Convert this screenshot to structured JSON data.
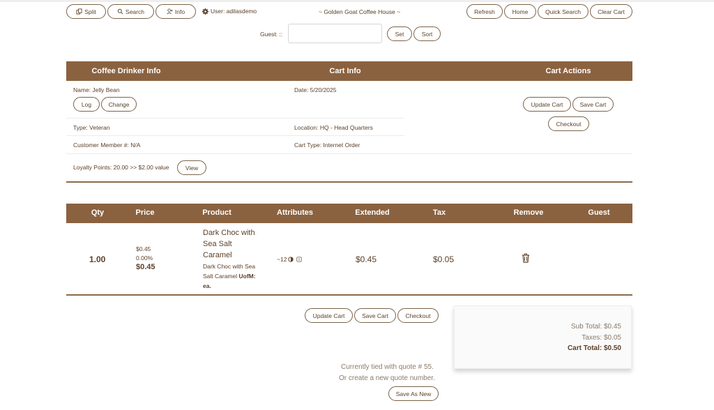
{
  "header": {
    "split_label": "Split",
    "search_label": "Search",
    "info_label": "Info",
    "user_text": "User: adilasdemo",
    "store_name": "~ Golden Goat Coffee House ~",
    "refresh_label": "Refresh",
    "home_label": "Home",
    "quick_search_label": "Quick Search",
    "clear_cart_label": "Clear Cart"
  },
  "guest": {
    "label": "Guest: ::",
    "value": "",
    "set_label": "Set",
    "sort_label": "Sort"
  },
  "info_header": {
    "col1": "Coffee Drinker Info",
    "col2": "Cart Info",
    "col3": "Cart Actions"
  },
  "drinker": {
    "name": "Name: Jelly Bean",
    "log_label": "Log",
    "change_label": "Change",
    "type": "Type: Veteran",
    "member": "Customer Member #: N/A",
    "loyalty": "Loyalty Points: 20.00 >> $2.00 value",
    "view_label": "View"
  },
  "cart_info": {
    "date": "Date: 5/20/2025",
    "location": "Location: HQ - Head Quarters",
    "cart_type": "Cart Type: Internet Order"
  },
  "cart_actions": {
    "update_label": "Update Cart",
    "save_label": "Save Cart",
    "checkout_label": "Checkout"
  },
  "items_table": {
    "columns": [
      "Qty",
      "Price",
      "Product",
      "Attributes",
      "Extended",
      "Tax",
      "Remove",
      "Guest"
    ],
    "rows": [
      {
        "qty": "1.00",
        "price_unit": "$0.45",
        "price_discount": "0.00%",
        "price_final": "$0.45",
        "product_line1": "Dark Choc with",
        "product_line2": "Sea Salt",
        "product_line3": "Caramel",
        "desc_line1": "Dark Choc with Sea",
        "desc_line2_pre": "Salt Caramel ",
        "desc_uofm": "UofM:",
        "desc_line3": "ea.",
        "attributes": "~12",
        "extended": "$0.45",
        "tax": "$0.05"
      }
    ]
  },
  "bottom_actions": {
    "update_label": "Update Cart",
    "save_label": "Save Cart",
    "checkout_label": "Checkout"
  },
  "summary": {
    "subtotal": "Sub Total: $0.45",
    "taxes": "Taxes: $0.05",
    "total": "Cart Total: $0.50"
  },
  "quote": {
    "tied_text": "Currently tied with quote # 55.",
    "new_text": "Or create a new quote number.",
    "save_as_new_label": "Save As New"
  },
  "colors": {
    "brand_brown": "#8b6240",
    "text_brown": "#5c4028"
  }
}
